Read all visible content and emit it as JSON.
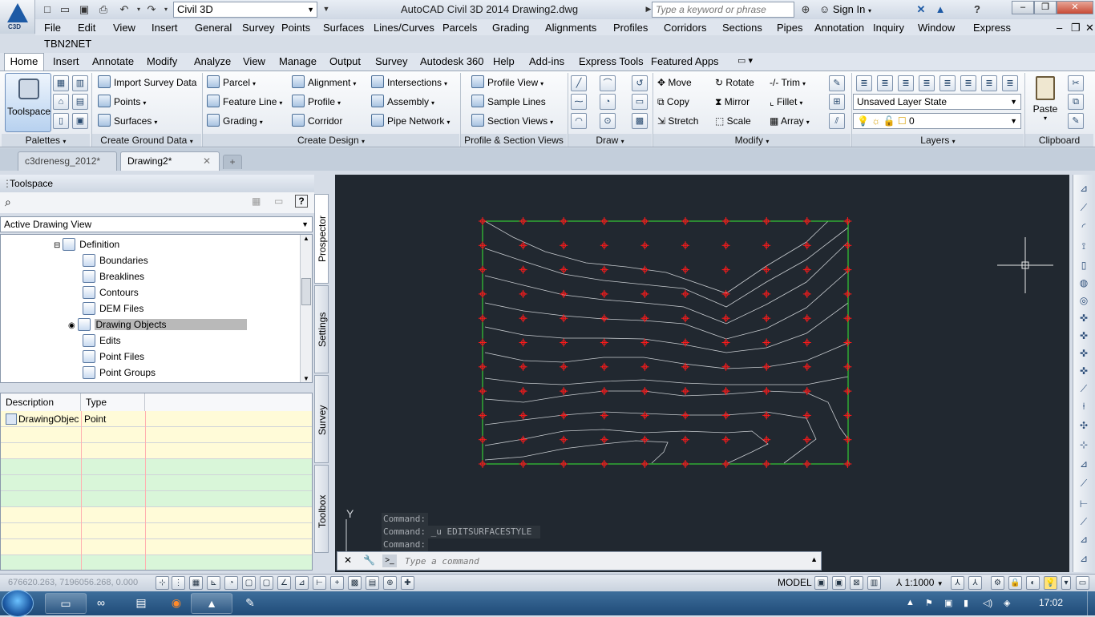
{
  "app": {
    "workspace": "Civil 3D",
    "title": "AutoCAD Civil 3D 2014    Drawing2.dwg",
    "search_placeholder": "Type a keyword or phrase",
    "sign_in": "Sign In",
    "logo_text": "C3D"
  },
  "menubar": [
    "File",
    "Edit",
    "View",
    "Insert",
    "General",
    "Survey",
    "Points",
    "Surfaces",
    "Lines/Curves",
    "Parcels",
    "Grading",
    "Alignments",
    "Profiles",
    "Corridors",
    "Sections",
    "Pipes",
    "Annotation",
    "Inquiry",
    "Window",
    "Express"
  ],
  "menubar2": "TBN2NET",
  "ribbon_tabs": [
    "Home",
    "Insert",
    "Annotate",
    "Modify",
    "Analyze",
    "View",
    "Manage",
    "Output",
    "Survey",
    "Autodesk 360",
    "Help",
    "Add-ins",
    "Express Tools",
    "Featured Apps"
  ],
  "ribbon": {
    "toolspace_label": "Toolspace",
    "ground": {
      "import_survey": "Import Survey Data",
      "points": "Points",
      "surfaces": "Surfaces"
    },
    "design_col1": {
      "parcel": "Parcel",
      "feature_line": "Feature Line",
      "grading": "Grading"
    },
    "design_col2": {
      "alignment": "Alignment",
      "profile": "Profile",
      "corridor": "Corridor"
    },
    "design_col3": {
      "intersections": "Intersections",
      "assembly": "Assembly",
      "pipe_network": "Pipe Network"
    },
    "profile_views": {
      "profile_view": "Profile View",
      "sample_lines": "Sample Lines",
      "section_views": "Section Views"
    },
    "modify": {
      "move": "Move",
      "copy": "Copy",
      "stretch": "Stretch",
      "rotate": "Rotate",
      "mirror": "Mirror",
      "scale": "Scale",
      "trim": "Trim",
      "fillet": "Fillet",
      "array": "Array"
    },
    "layers": {
      "layer_state": "Unsaved Layer State",
      "current_layer": "0"
    },
    "clipboard": {
      "paste": "Paste"
    },
    "panels": {
      "palettes": "Palettes",
      "ground_data": "Create Ground Data",
      "design": "Create Design",
      "profile_section": "Profile & Section Views",
      "draw": "Draw",
      "modify": "Modify",
      "layers": "Layers",
      "clipboard": "Clipboard"
    }
  },
  "doc_tabs": [
    "c3drenesg_2012*",
    "Drawing2*"
  ],
  "toolspace": {
    "header": "Toolspace",
    "view_combo": "Active Drawing View",
    "tree": [
      "Definition",
      "Boundaries",
      "Breaklines",
      "Contours",
      "DEM Files",
      "Drawing Objects",
      "Edits",
      "Point Files",
      "Point Groups"
    ],
    "grid_headers": [
      "Description",
      "Type"
    ],
    "grid_row": {
      "description": "DrawingObjec",
      "type": "Point"
    },
    "side_tabs": [
      "Prospector",
      "Settings",
      "Survey",
      "Toolbox"
    ]
  },
  "command": {
    "history": [
      "Command:",
      "Command: _u EDITSURFACESTYLE",
      "Command:"
    ],
    "placeholder": "Type a command"
  },
  "status": {
    "coords": "676620.263, 7196056.268, 0.000",
    "model": "MODEL",
    "scale": "1:1000"
  },
  "taskbar": {
    "clock": "17:02"
  },
  "colors": {
    "canvas": "#212830",
    "point_marker": "#ff1a1a",
    "boundary": "#33cc33",
    "contour": "#c8ccd0"
  }
}
